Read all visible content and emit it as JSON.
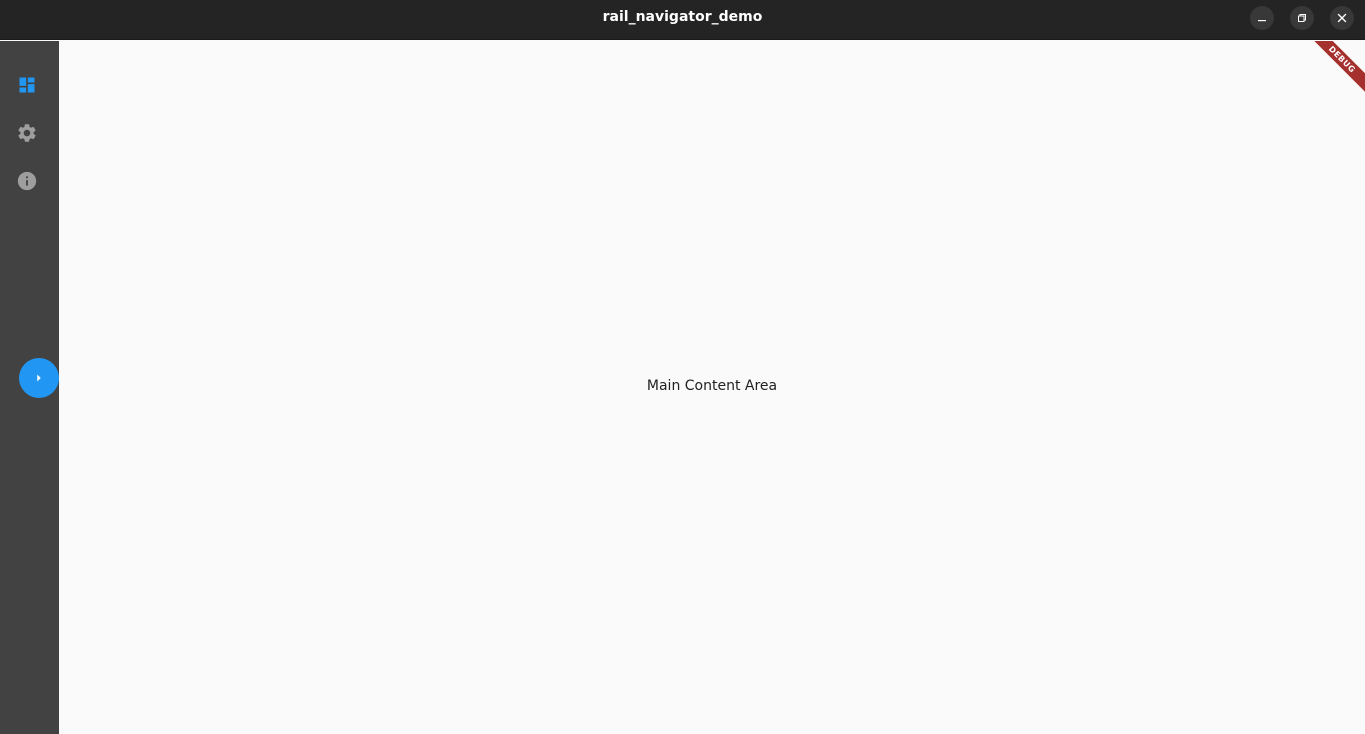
{
  "window": {
    "title": "rail_navigator_demo",
    "controls": {
      "minimize_icon": "minimize-icon",
      "maximize_icon": "restore-icon",
      "close_icon": "close-icon"
    }
  },
  "rail": {
    "items": [
      {
        "icon": "dashboard-icon",
        "selected": true
      },
      {
        "icon": "gear-icon",
        "selected": false
      },
      {
        "icon": "info-icon",
        "selected": false
      }
    ],
    "expand_button_icon": "chevron-right-icon",
    "colors": {
      "background": "#424242",
      "selected": "#2196f3",
      "unselected": "#9e9e9e"
    }
  },
  "main": {
    "text": "Main Content Area"
  },
  "debug_banner": {
    "text": "DEBUG",
    "color": "#a5312f"
  }
}
